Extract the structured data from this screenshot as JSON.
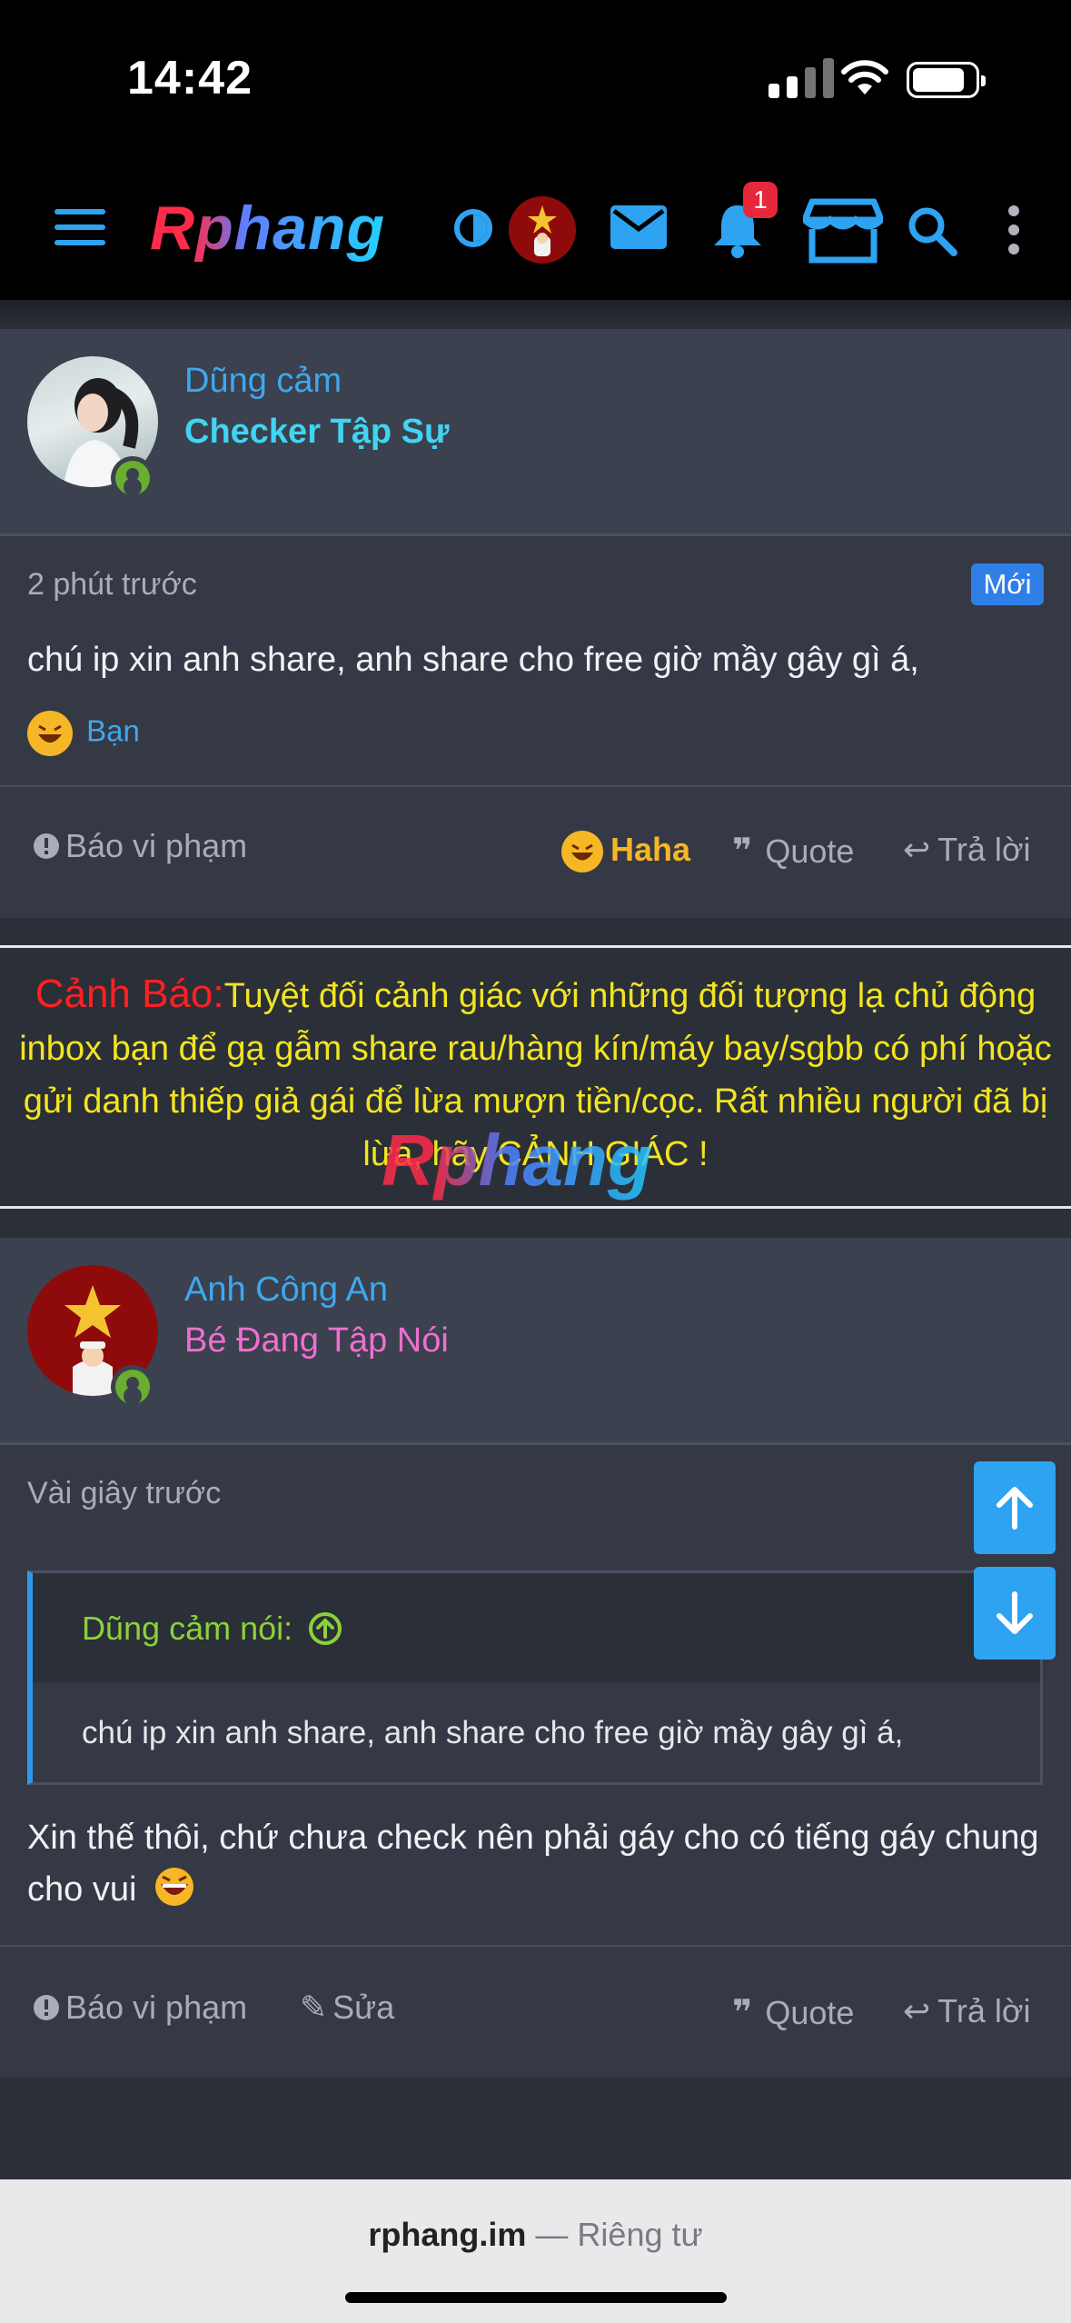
{
  "status": {
    "time": "14:42"
  },
  "nav": {
    "logo": "Rphang",
    "notifications_count": "1"
  },
  "posts": [
    {
      "author": "Dũng cảm",
      "title": "Checker Tập Sự",
      "time": "2 phút trước",
      "new_badge": "Mới",
      "body": "chú ip xin anh share, anh share cho free giờ mầy gây gì á,",
      "reaction_by": "Bạn",
      "actions": {
        "report": "Báo vi phạm",
        "reaction": "Haha",
        "quote": "Quote",
        "reply": "Trả lời"
      },
      "colors": {
        "title": "#3fd5f2"
      }
    },
    {
      "author": "Anh Công An",
      "title": "Bé Đang Tập Nói",
      "time": "Vài giây trước",
      "quote": {
        "author": "Dũng cảm nói:",
        "text": "chú ip xin anh share, anh share cho free giờ mầy gây gì á,"
      },
      "body": "Xin thế thôi, chứ chưa check nên phải gáy cho có tiếng gáy chung cho vui",
      "actions": {
        "report": "Báo vi phạm",
        "edit": "Sửa",
        "quote": "Quote",
        "reply": "Trả lời"
      },
      "colors": {
        "title": "#ef6fcf"
      }
    }
  ],
  "warning": {
    "label": "Cảnh Báo:",
    "text": "Tuyệt đối cảnh giác với những đối tượng lạ chủ động inbox bạn để gạ gẫm share rau/hàng kín/máy bay/sgbb có phí hoặc gửi danh thiếp giả gái để lừa mượn tiền/cọc. Rất nhiều người đã bị lừa, hãy CẢNH GIÁC !",
    "watermark": "Rphang"
  },
  "browser": {
    "domain": "rphang.im",
    "suffix": "— Riêng tư"
  },
  "icons": [
    "menu-icon",
    "contrast-icon",
    "mail-icon",
    "bell-icon",
    "store-icon",
    "search-icon",
    "more-vertical-icon",
    "arrow-up-icon",
    "arrow-down-icon",
    "report-icon",
    "quote-icon",
    "reply-icon",
    "edit-icon",
    "haha-emoji-icon",
    "laughing-emoji-icon"
  ]
}
